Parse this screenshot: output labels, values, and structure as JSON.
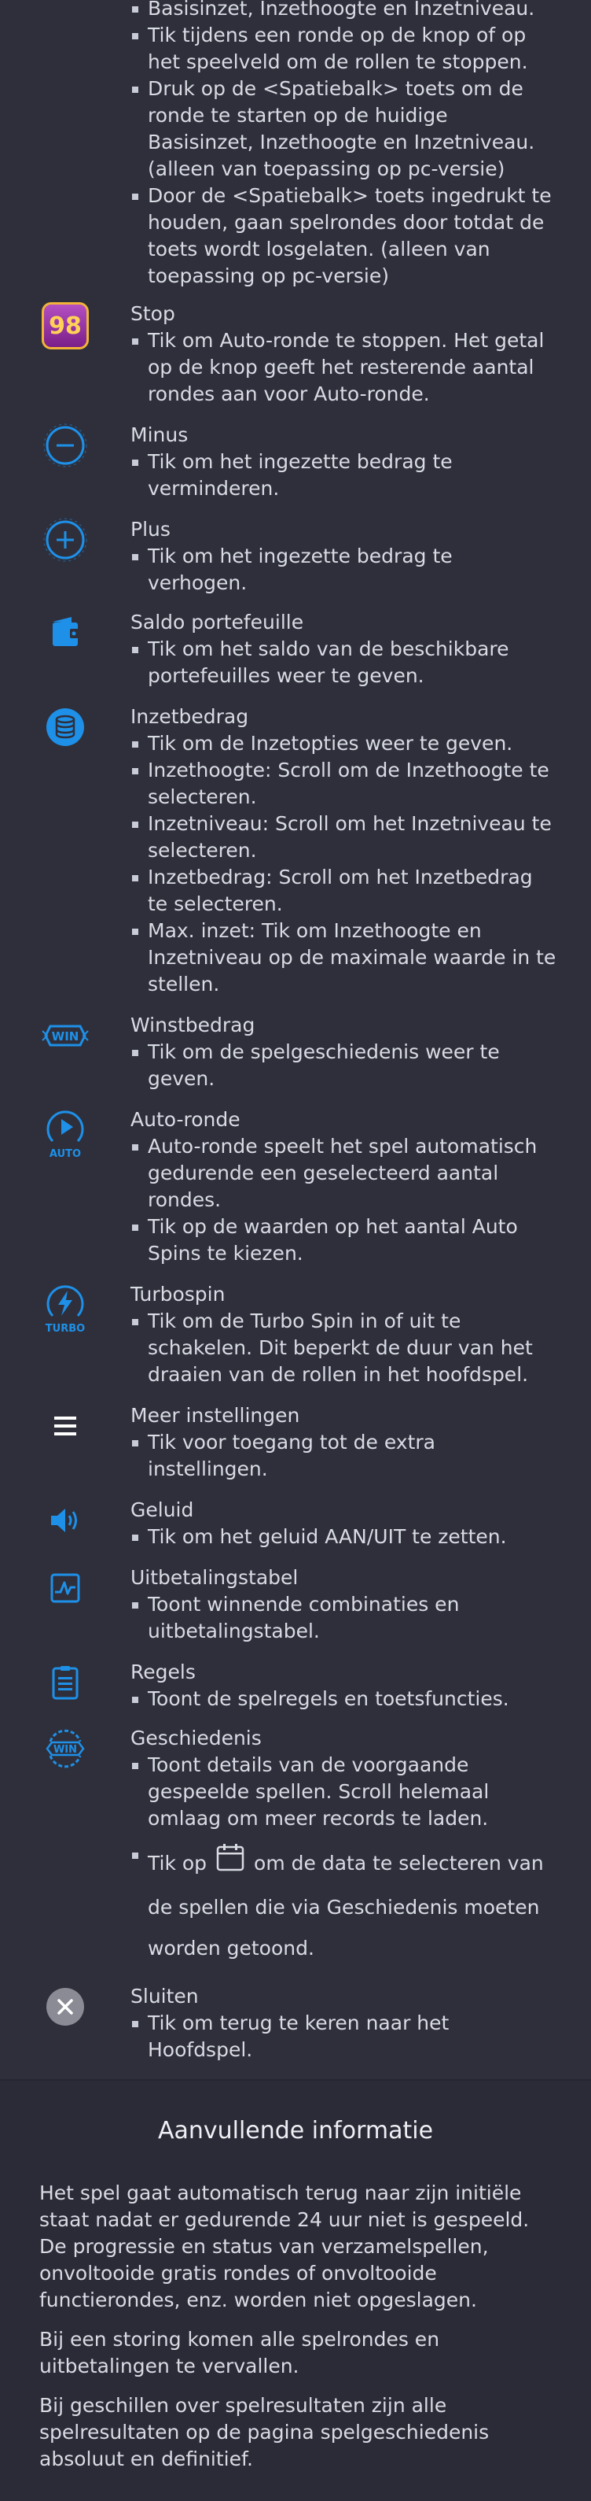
{
  "intro_bullets": [
    "Basisinzet, Inzethoogte en Inzetniveau.",
    "Tik tijdens een ronde op de knop of op het speelveld om de rollen te stoppen.",
    "Druk op de <Spatiebalk> toets om de ronde te starten op de huidige Basisinzet, Inzethoogte en Inzetniveau. (alleen van toepassing op pc-versie)",
    "Door de <Spatiebalk> toets ingedrukt te houden, gaan spelrondes door totdat de toets wordt losgelaten. (alleen van toepassing op pc-versie)"
  ],
  "stop": {
    "badge": "98",
    "title": "Stop",
    "bullets": [
      "Tik om Auto-ronde te stoppen. Het getal op de knop geeft het resterende aantal rondes aan voor Auto-ronde."
    ]
  },
  "minus": {
    "title": "Minus",
    "bullets": [
      "Tik om het ingezette bedrag te verminderen."
    ]
  },
  "plus": {
    "title": "Plus",
    "bullets": [
      "Tik om het ingezette bedrag te verhogen."
    ]
  },
  "wallet": {
    "title": "Saldo portefeuille",
    "bullets": [
      "Tik om het saldo van de beschikbare portefeuilles weer te geven."
    ]
  },
  "bet": {
    "title": "Inzetbedrag",
    "bullets": [
      "Tik om de Inzetopties weer te geven.",
      "Inzethoogte: Scroll om de Inzethoogte te selecteren.",
      "Inzetniveau: Scroll om het Inzetniveau te selecteren.",
      "Inzetbedrag: Scroll om het Inzetbedrag te selecteren.",
      "Max. inzet: Tik om Inzethoogte en Inzetniveau op de maximale waarde in te stellen."
    ]
  },
  "win": {
    "badge": "WIN",
    "title": "Winstbedrag",
    "bullets": [
      "Tik om de spelgeschiedenis weer te geven."
    ]
  },
  "auto": {
    "label": "AUTO",
    "title": "Auto-ronde",
    "bullets": [
      "Auto-ronde speelt het spel automatisch gedurende een geselecteerd aantal rondes.",
      "Tik op de waarden op het aantal Auto Spins te kiezen."
    ]
  },
  "turbo": {
    "label": "TURBO",
    "title": "Turbospin",
    "bullets": [
      "Tik om de Turbo Spin in of uit te schakelen. Dit beperkt de duur van het draaien van de rollen in het hoofdspel."
    ]
  },
  "menu": {
    "title": "Meer instellingen",
    "bullets": [
      "Tik voor toegang tot de extra instellingen."
    ]
  },
  "sound": {
    "title": "Geluid",
    "bullets": [
      "Tik om het geluid AAN/UIT te zetten."
    ]
  },
  "paytable": {
    "title": "Uitbetalingstabel",
    "bullets": [
      "Toont winnende combinaties en uitbetalingstabel."
    ]
  },
  "rules": {
    "title": "Regels",
    "bullets": [
      "Toont de spelregels en toetsfuncties."
    ]
  },
  "history": {
    "badge": "WIN",
    "title": "Geschiedenis",
    "bullet1": "Toont details van de voorgaande gespeelde spellen. Scroll helemaal omlaag om meer records te laden.",
    "bullet2_pre": "Tik op",
    "bullet2_post": "om de data te selecteren van de spellen die via Geschiedenis moeten worden getoond."
  },
  "close": {
    "title": "Sluiten",
    "bullets": [
      "Tik om terug te keren naar het Hoofdspel."
    ]
  },
  "extra": {
    "heading": "Aanvullende informatie",
    "paragraphs": [
      "Het spel gaat automatisch terug naar zijn initiële staat nadat er gedurende 24 uur niet is gespeeld. De progressie en status van verzamelspellen, onvoltooide gratis rondes of onvoltooide functierondes, enz. worden niet opgeslagen.",
      "Bij een storing komen alle spelrondes en uitbetalingen te vervallen.",
      "Bij geschillen over spelresultaten zijn alle spelresultaten op de pagina spelgeschiedenis absoluut en definitief."
    ]
  },
  "colors": {
    "accent": "#1e90e8",
    "background": "#2e2f3b",
    "text": "#d9dbe3",
    "badge": "#8b2a9a"
  }
}
